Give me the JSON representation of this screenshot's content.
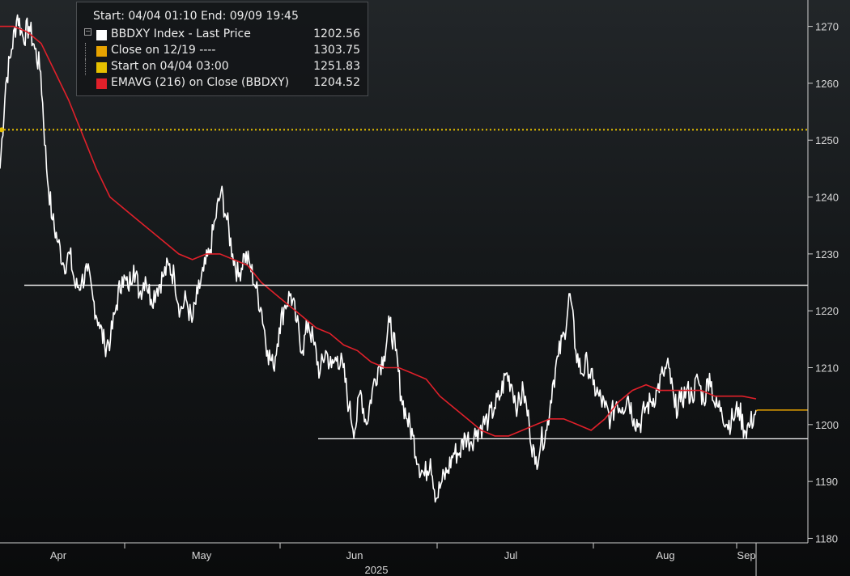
{
  "chart_data": {
    "type": "line",
    "ylim": [
      1178.5,
      1273.5
    ],
    "yticks": [
      1180,
      1190,
      1200,
      1210,
      1220,
      1230,
      1240,
      1250,
      1260,
      1270
    ],
    "x_month_labels": [
      "Apr",
      "May",
      "Jun",
      "Jul",
      "Aug",
      "Sep"
    ],
    "x_year_label": "2025",
    "x_start": "04/04 01:10",
    "x_end": "09/09 19:45",
    "grid": false,
    "legend_position": "top-left",
    "colors": {
      "price": "#ffffff",
      "close": "#e8a300",
      "start": "#e6c000",
      "emavg": "#e0202a",
      "support": "#ffffff"
    },
    "legend": {
      "header": "Start: 04/04 01:10 End: 09/09 19:45",
      "entries": [
        {
          "name": "BBDXY Index - Last Price",
          "value": "1202.56",
          "color": "#ffffff"
        },
        {
          "name": "Close on 12/19 ----",
          "value": "1303.75",
          "color": "#e8a300"
        },
        {
          "name": "Start on 04/04 03:00",
          "value": "1251.83",
          "color": "#e6c000"
        },
        {
          "name": "EMAVG (216)  on Close (BBDXY)",
          "value": "1204.52",
          "color": "#e0202a"
        }
      ]
    },
    "series": [
      {
        "name": "BBDXY Index - Last Price",
        "x_start": "2025-04-04",
        "x_end": "2025-09-09",
        "points": [
          [
            "04/04",
            1245
          ],
          [
            "04/04",
            1260
          ],
          [
            "04/05",
            1266
          ],
          [
            "04/06",
            1272
          ],
          [
            "04/07",
            1268
          ],
          [
            "04/08",
            1270
          ],
          [
            "04/09",
            1266
          ],
          [
            "04/10",
            1262
          ],
          [
            "04/11",
            1245
          ],
          [
            "04/12",
            1236
          ],
          [
            "04/13",
            1232
          ],
          [
            "04/14",
            1228
          ],
          [
            "04/15",
            1230
          ],
          [
            "04/16",
            1224
          ],
          [
            "04/17",
            1225
          ],
          [
            "04/18",
            1227
          ],
          [
            "04/19",
            1222
          ],
          [
            "04/20",
            1218
          ],
          [
            "04/21",
            1214
          ],
          [
            "04/22",
            1215
          ],
          [
            "04/23",
            1221
          ],
          [
            "04/24",
            1226
          ],
          [
            "04/25",
            1224
          ],
          [
            "04/26",
            1228
          ],
          [
            "04/27",
            1223
          ],
          [
            "04/28",
            1226
          ],
          [
            "04/29",
            1222
          ],
          [
            "04/30",
            1224
          ],
          [
            "05/01",
            1226
          ],
          [
            "05/02",
            1228
          ],
          [
            "05/03",
            1226
          ],
          [
            "05/04",
            1220
          ],
          [
            "05/05",
            1222
          ],
          [
            "05/06",
            1218
          ],
          [
            "05/07",
            1223
          ],
          [
            "05/08",
            1227
          ],
          [
            "05/09",
            1230
          ],
          [
            "05/10",
            1236
          ],
          [
            "05/11",
            1241
          ],
          [
            "05/12",
            1236
          ],
          [
            "05/13",
            1230
          ],
          [
            "05/14",
            1226
          ],
          [
            "05/15",
            1230
          ],
          [
            "05/16",
            1228
          ],
          [
            "05/17",
            1224
          ],
          [
            "05/18",
            1220
          ],
          [
            "05/19",
            1213
          ],
          [
            "05/20",
            1210
          ],
          [
            "05/21",
            1217
          ],
          [
            "05/22",
            1221
          ],
          [
            "05/23",
            1223
          ],
          [
            "05/24",
            1218
          ],
          [
            "05/25",
            1213
          ],
          [
            "05/26",
            1218
          ],
          [
            "05/27",
            1214
          ],
          [
            "05/28",
            1209
          ],
          [
            "05/29",
            1213
          ],
          [
            "05/30",
            1210
          ],
          [
            "05/31",
            1212
          ],
          [
            "06/01",
            1210
          ],
          [
            "06/02",
            1203
          ],
          [
            "06/03",
            1199
          ],
          [
            "06/04",
            1206
          ],
          [
            "06/05",
            1200
          ],
          [
            "06/06",
            1206
          ],
          [
            "06/07",
            1210
          ],
          [
            "06/08",
            1212
          ],
          [
            "06/09",
            1218
          ],
          [
            "06/10",
            1213
          ],
          [
            "06/11",
            1205
          ],
          [
            "06/12",
            1201
          ],
          [
            "06/13",
            1198
          ],
          [
            "06/14",
            1193
          ],
          [
            "06/15",
            1191
          ],
          [
            "06/16",
            1194
          ],
          [
            "06/17",
            1187
          ],
          [
            "06/18",
            1190
          ],
          [
            "06/19",
            1192
          ],
          [
            "06/20",
            1195
          ],
          [
            "06/21",
            1195
          ],
          [
            "06/22",
            1198
          ],
          [
            "06/23",
            1197
          ],
          [
            "06/24",
            1199
          ],
          [
            "06/25",
            1200
          ],
          [
            "06/26",
            1201
          ],
          [
            "06/27",
            1203
          ],
          [
            "06/28",
            1205
          ],
          [
            "06/29",
            1209
          ],
          [
            "06/30",
            1207
          ],
          [
            "07/01",
            1203
          ],
          [
            "07/02",
            1206
          ],
          [
            "07/03",
            1200
          ],
          [
            "07/04",
            1193
          ],
          [
            "07/05",
            1197
          ],
          [
            "07/06",
            1199
          ],
          [
            "07/07",
            1207
          ],
          [
            "07/08",
            1212
          ],
          [
            "07/09",
            1216
          ],
          [
            "07/10",
            1223
          ],
          [
            "07/11",
            1213
          ],
          [
            "07/12",
            1209
          ],
          [
            "07/13",
            1211
          ],
          [
            "07/14",
            1207
          ],
          [
            "07/15",
            1205
          ],
          [
            "07/16",
            1203
          ],
          [
            "07/17",
            1201
          ],
          [
            "07/18",
            1204
          ],
          [
            "07/19",
            1203
          ],
          [
            "07/20",
            1205
          ],
          [
            "07/21",
            1201
          ],
          [
            "07/22",
            1200
          ],
          [
            "07/23",
            1203
          ],
          [
            "07/24",
            1204
          ],
          [
            "07/25",
            1206
          ],
          [
            "07/26",
            1209
          ],
          [
            "07/27",
            1210
          ],
          [
            "07/28",
            1203
          ],
          [
            "07/29",
            1204
          ],
          [
            "07/30",
            1206
          ],
          [
            "07/31",
            1205
          ],
          [
            "08/01",
            1208
          ],
          [
            "08/02",
            1204
          ],
          [
            "08/03",
            1209
          ],
          [
            "08/04",
            1203
          ],
          [
            "08/05",
            1203
          ],
          [
            "08/06",
            1200
          ],
          [
            "08/07",
            1201
          ],
          [
            "08/08",
            1203
          ],
          [
            "08/09",
            1199
          ],
          [
            "08/10",
            1200
          ],
          [
            "08/11",
            1202.56
          ]
        ]
      },
      {
        "name": "EMAVG (216)  on Close (BBDXY)",
        "points": [
          [
            "04/04",
            1270
          ],
          [
            "04/06",
            1270
          ],
          [
            "04/08",
            1269
          ],
          [
            "04/10",
            1267
          ],
          [
            "04/12",
            1262
          ],
          [
            "04/14",
            1257
          ],
          [
            "04/16",
            1251
          ],
          [
            "04/18",
            1245
          ],
          [
            "04/20",
            1240
          ],
          [
            "04/22",
            1238
          ],
          [
            "04/24",
            1236
          ],
          [
            "04/26",
            1234
          ],
          [
            "04/28",
            1232
          ],
          [
            "04/30",
            1230
          ],
          [
            "05/02",
            1229
          ],
          [
            "05/04",
            1230
          ],
          [
            "05/06",
            1230
          ],
          [
            "05/08",
            1229
          ],
          [
            "05/10",
            1228
          ],
          [
            "05/12",
            1225
          ],
          [
            "05/14",
            1223
          ],
          [
            "05/16",
            1221
          ],
          [
            "05/18",
            1219
          ],
          [
            "05/20",
            1217
          ],
          [
            "05/22",
            1216
          ],
          [
            "05/24",
            1214
          ],
          [
            "05/26",
            1213
          ],
          [
            "05/28",
            1211
          ],
          [
            "05/30",
            1210
          ],
          [
            "06/01",
            1210
          ],
          [
            "06/03",
            1209
          ],
          [
            "06/05",
            1208
          ],
          [
            "06/07",
            1205
          ],
          [
            "06/09",
            1203
          ],
          [
            "06/11",
            1201
          ],
          [
            "06/13",
            1199
          ],
          [
            "06/15",
            1198
          ],
          [
            "06/17",
            1198
          ],
          [
            "06/19",
            1199
          ],
          [
            "06/21",
            1200
          ],
          [
            "06/23",
            1201
          ],
          [
            "06/25",
            1201
          ],
          [
            "06/27",
            1200
          ],
          [
            "06/29",
            1199
          ],
          [
            "07/01",
            1201
          ],
          [
            "07/03",
            1204
          ],
          [
            "07/05",
            1206
          ],
          [
            "07/07",
            1207
          ],
          [
            "07/09",
            1206
          ],
          [
            "07/11",
            1206
          ],
          [
            "07/13",
            1206
          ],
          [
            "07/15",
            1206
          ],
          [
            "07/17",
            1205
          ],
          [
            "07/19",
            1205
          ],
          [
            "07/21",
            1205
          ],
          [
            "07/23",
            1204.52
          ]
        ]
      },
      {
        "name": "Start on 04/04 03:00",
        "value": 1251.83
      }
    ],
    "reference_lines": [
      1224.5,
      1197.5
    ],
    "last_price_marker": 1202.56
  }
}
